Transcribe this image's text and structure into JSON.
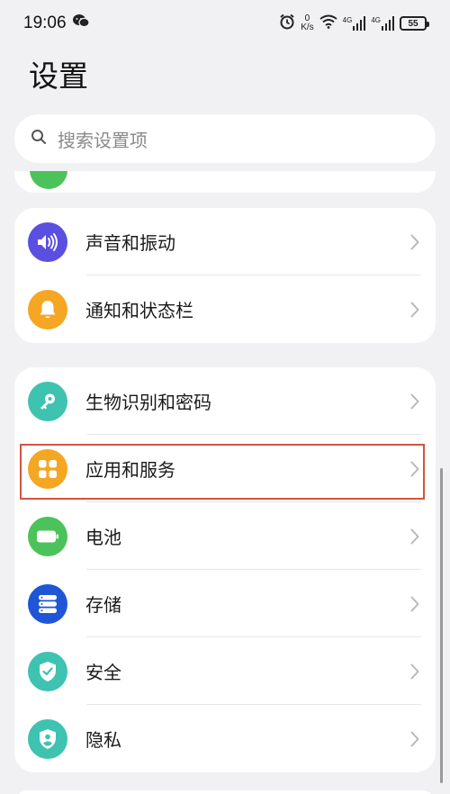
{
  "status_bar": {
    "time": "19:06",
    "net_speed_value": "0",
    "net_speed_unit": "K/s",
    "signal_label_1": "4G",
    "signal_label_2": "4G",
    "battery_level": "55"
  },
  "page": {
    "title": "设置"
  },
  "search": {
    "placeholder": "搜索设置项"
  },
  "groups": [
    {
      "items": [
        {
          "label": "声音和振动",
          "icon": "speaker-icon",
          "color": "#5a4fe0"
        },
        {
          "label": "通知和状态栏",
          "icon": "bell-icon",
          "color": "#f5a623"
        }
      ]
    },
    {
      "items": [
        {
          "label": "生物识别和密码",
          "icon": "key-icon",
          "color": "#3ec3b0"
        },
        {
          "label": "应用和服务",
          "icon": "apps-grid-icon",
          "color": "#f5a623",
          "selected": true
        },
        {
          "label": "电池",
          "icon": "battery-icon",
          "color": "#4cc35a"
        },
        {
          "label": "存储",
          "icon": "storage-icon",
          "color": "#1f56d6"
        },
        {
          "label": "安全",
          "icon": "shield-check-icon",
          "color": "#3ec3b0"
        },
        {
          "label": "隐私",
          "icon": "privacy-shield-icon",
          "color": "#3ec3b0"
        }
      ]
    }
  ],
  "colors": {
    "background": "#f1f1f3",
    "card": "#ffffff",
    "highlight_border": "#d2543c",
    "chevron": "#b8b8b8"
  }
}
